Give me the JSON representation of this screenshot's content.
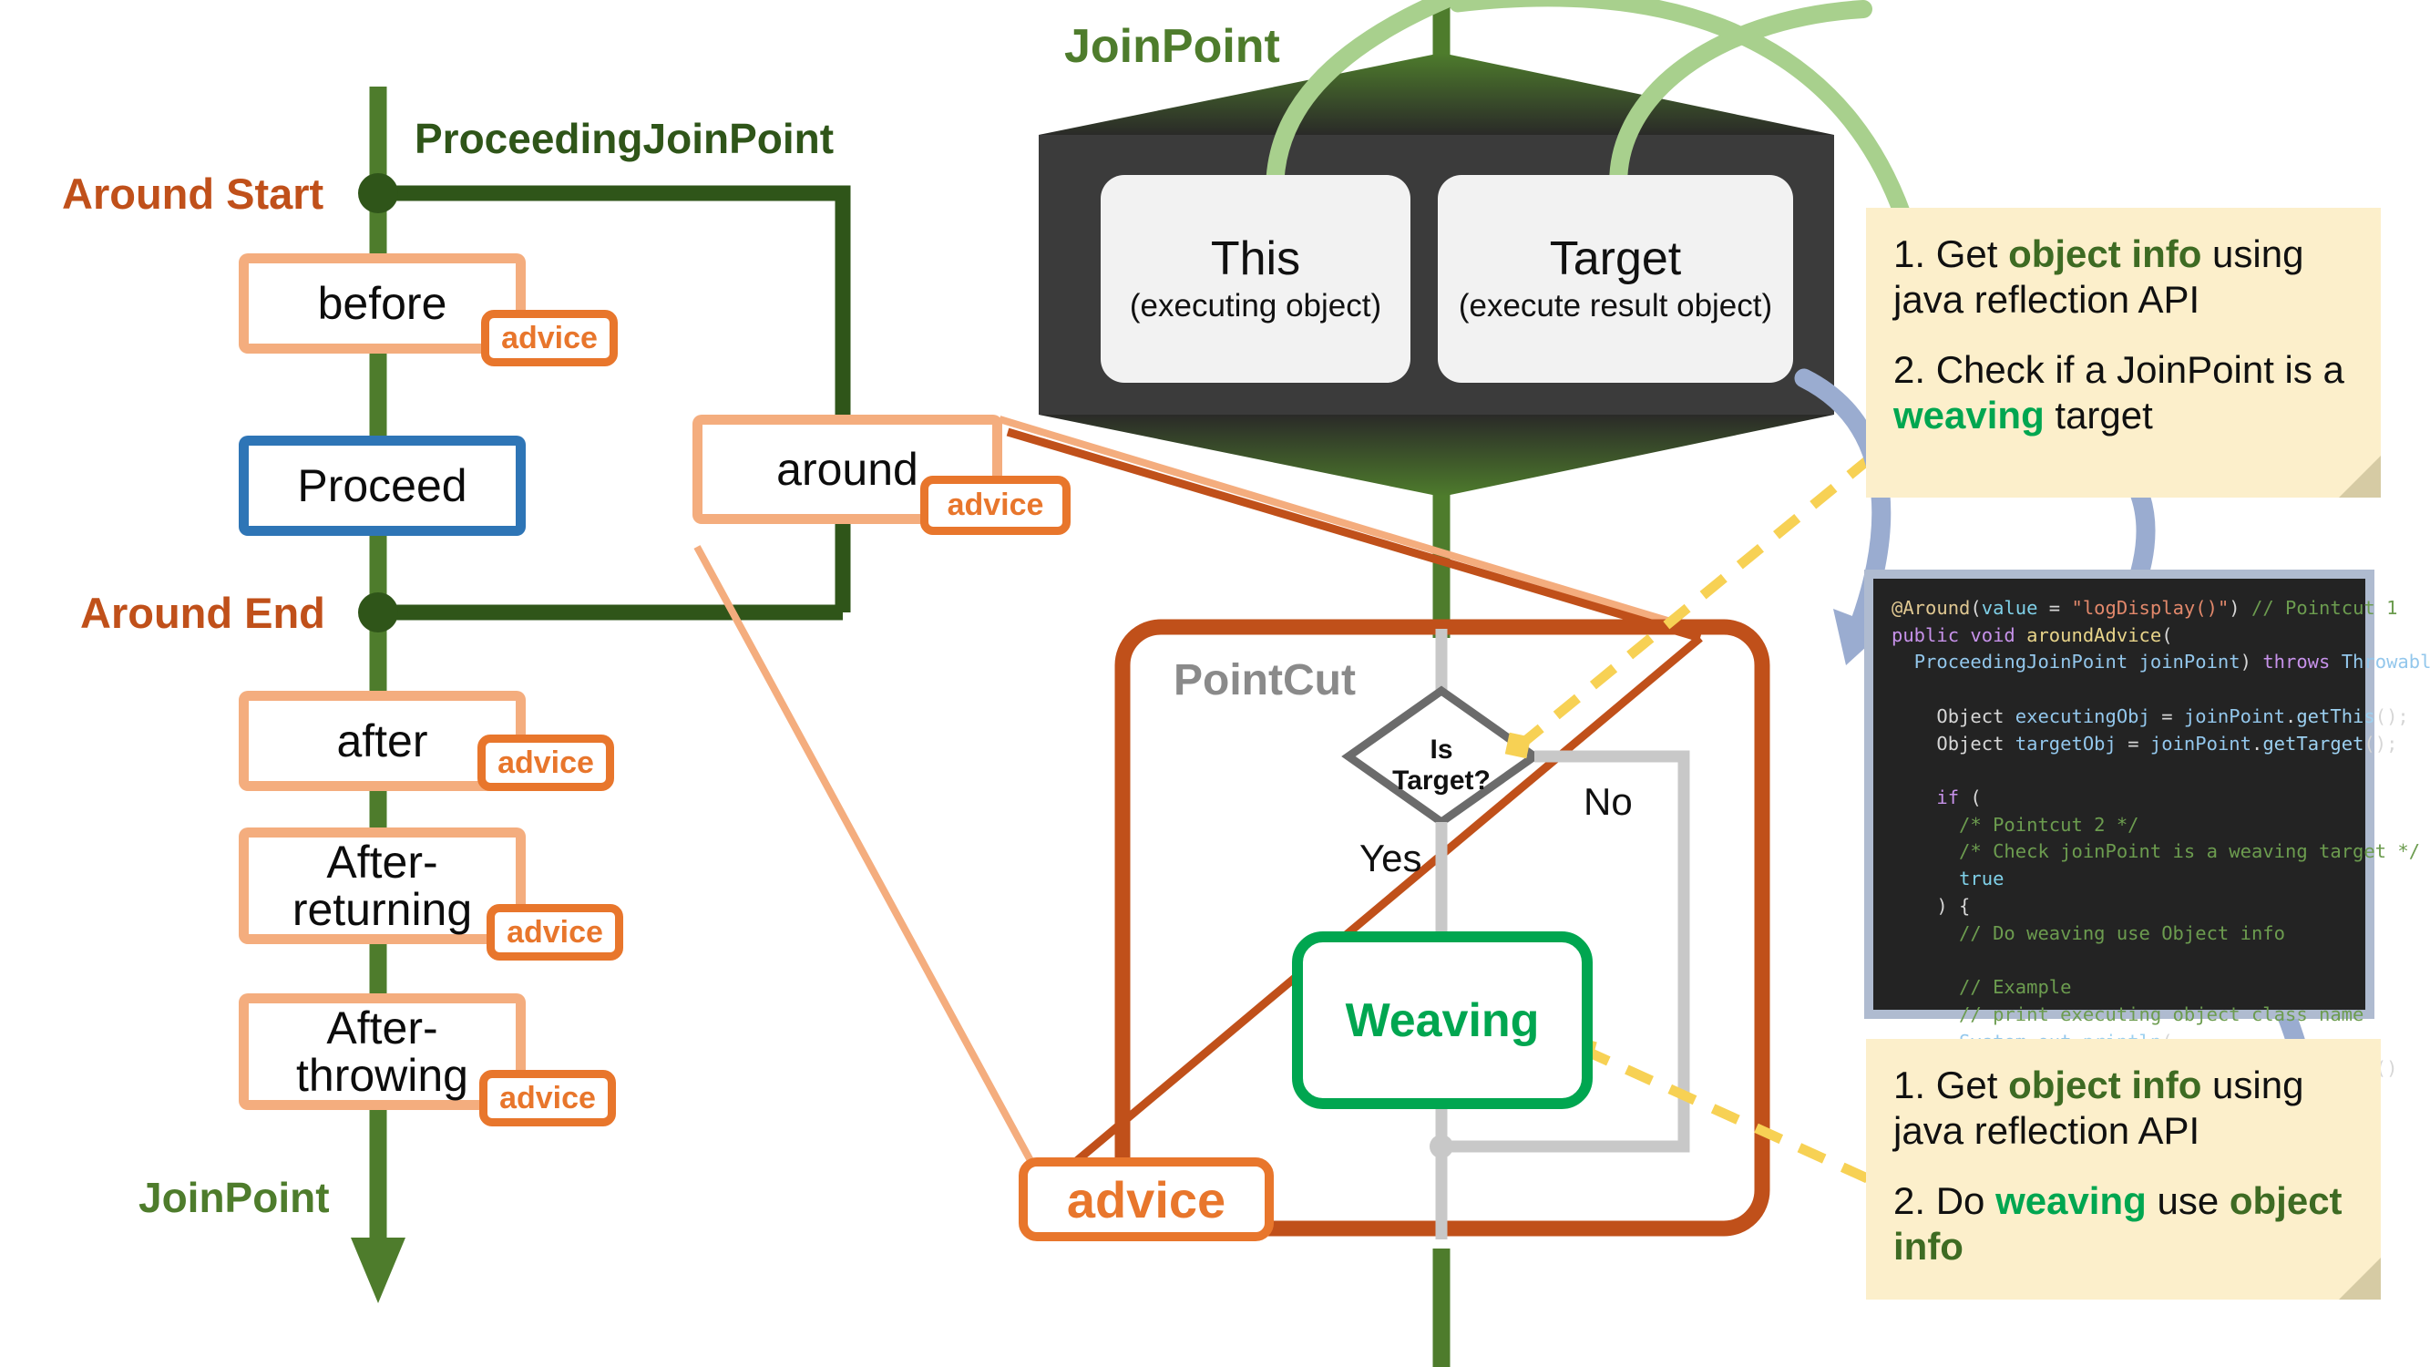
{
  "left_flow": {
    "title_pjp": "ProceedingJoinPoint",
    "around_start": "Around Start",
    "around_end": "Around End",
    "joinpoint_label": "JoinPoint",
    "advice_tag": "advice",
    "steps": [
      {
        "name": "before",
        "tag": "advice"
      },
      {
        "name": "Proceed",
        "tag": ""
      },
      {
        "name": "after",
        "tag": "advice"
      },
      {
        "name": "After-returning",
        "tag": "advice"
      },
      {
        "name": "After-throwing",
        "tag": "advice"
      }
    ],
    "around": {
      "name": "around",
      "tag": "advice"
    }
  },
  "joinpoint_block": {
    "title": "JoinPoint",
    "objects": [
      {
        "name": "This",
        "sub": "(executing object)"
      },
      {
        "name": "Target",
        "sub": "(execute result object)"
      }
    ]
  },
  "pointcut": {
    "title": "PointCut",
    "decision_line1": "Is",
    "decision_line2": "Target?",
    "yes": "Yes",
    "no": "No",
    "weaving": "Weaving",
    "advice_tag": "advice"
  },
  "notes": [
    {
      "line1_a": "1. Get ",
      "line1_b": "object info",
      "line1_c": " using java reflection API",
      "line2_a": "2. Check if a JoinPoint is a ",
      "line2_b": "weaving",
      "line2_c": " target"
    },
    {
      "line1_a": "1. Get ",
      "line1_b": "object info",
      "line1_c": " using java reflection API",
      "line2_a": "2. Do ",
      "line2_b": "weaving",
      "line2_c": " use ",
      "line2_d": "object info"
    }
  ],
  "code": {
    "text": "@Around(value = \"logDisplay()\") // Pointcut 1\npublic void aroundAdvice(\n  ProceedingJoinPoint joinPoint) throws Throwable {\n\n    Object executingObj = joinPoint.getThis();\n    Object targetObj = joinPoint.getTarget();\n\n    if (\n      /* Pointcut 2 */\n      /* Check joinPoint is a weaving target */\n      true\n    ) {\n      // Do weaving use Object info\n\n      // Example\n      // print executing object class name\n      System.out.println(\n            executingObj.getClass().getName()\n      );\n    }\n}"
  },
  "colors": {
    "joinpoint_green": "#4E7C2C",
    "pjp_dark_green": "#2F5519",
    "around_orange": "#C0501A",
    "advice_orange": "#E8762C",
    "step_peach": "#F4AD7E",
    "proceed_blue": "#2E75B6",
    "weaving_green": "#00A650",
    "pointcut_brown": "#C0501A",
    "note_yellow": "#FCEFCB",
    "dashed_yellow": "#F7D154",
    "arrow_blue": "#9AACD0",
    "arrow_lightgreen": "#A8D08D",
    "hex_dark": "#3B3B3B"
  }
}
